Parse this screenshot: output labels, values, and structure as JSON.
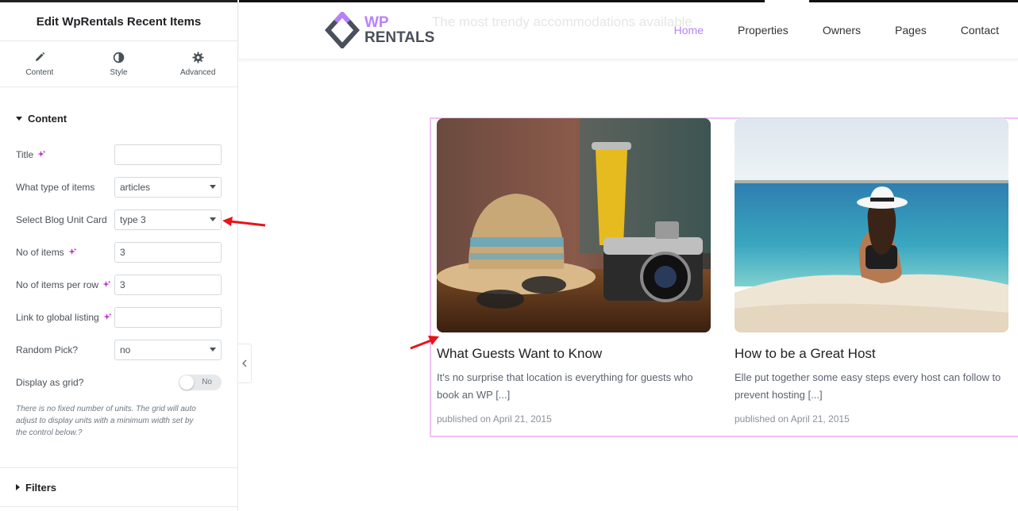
{
  "panel": {
    "title": "Edit WpRentals Recent Items",
    "tabs": [
      {
        "label": "Content"
      },
      {
        "label": "Style"
      },
      {
        "label": "Advanced"
      }
    ],
    "content_section": "Content",
    "fields": {
      "title": {
        "label": "Title",
        "value": ""
      },
      "type": {
        "label": "What type of items",
        "value": "articles"
      },
      "card": {
        "label": "Select Blog Unit Card",
        "value": "type 3"
      },
      "count": {
        "label": "No of items",
        "value": "3"
      },
      "per_row": {
        "label": "No of items per row",
        "value": "3"
      },
      "link": {
        "label": "Link to global listing",
        "value": ""
      },
      "random": {
        "label": "Random Pick?",
        "value": "no"
      },
      "grid": {
        "label": "Display as grid?",
        "toggle": "No"
      }
    },
    "help_text": "There is no fixed number of units. The grid will auto adjust to display units with a minimum width set by the control below.?",
    "filters_section": "Filters"
  },
  "site": {
    "tagline": "The most trendy accommodations available",
    "logo": {
      "line1": "WP",
      "line2": "RENTALS"
    },
    "nav": [
      {
        "label": "Home"
      },
      {
        "label": "Properties"
      },
      {
        "label": "Owners"
      },
      {
        "label": "Pages"
      },
      {
        "label": "Contact"
      }
    ],
    "cards": [
      {
        "title": "What Guests Want to Know",
        "excerpt": "It's no surprise that location is everything for guests who book an WP [...]",
        "date": "published on April 21, 2015"
      },
      {
        "title": "How to be a Great Host",
        "excerpt": "Elle put together some easy steps every host can follow to prevent hosting [...]",
        "date": "published on April 21, 2015"
      }
    ]
  },
  "colors": {
    "accent": "#b881fc",
    "ai_sparkle": "#c026d3",
    "annotation": "#e8141b"
  }
}
